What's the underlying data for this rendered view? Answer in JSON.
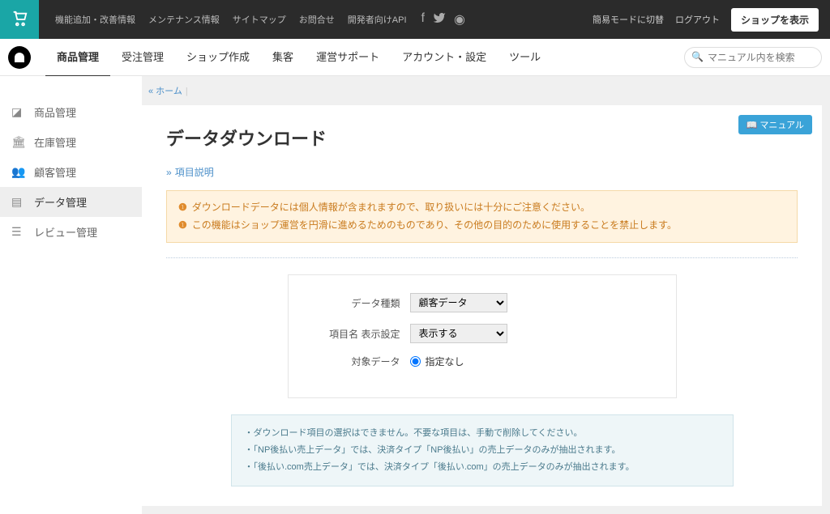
{
  "topbar": {
    "links": [
      "機能追加・改善情報",
      "メンテナンス情報",
      "サイトマップ",
      "お問合せ",
      "開発者向けAPI"
    ],
    "right": {
      "simple_mode": "簡易モードに切替",
      "logout": "ログアウト",
      "view_shop": "ショップを表示"
    }
  },
  "nav": {
    "items": [
      "商品管理",
      "受注管理",
      "ショップ作成",
      "集客",
      "運営サポート",
      "アカウント・設定",
      "ツール"
    ],
    "search_placeholder": "マニュアル内を検索"
  },
  "sidebar": {
    "items": [
      {
        "label": "商品管理",
        "icon": "cube"
      },
      {
        "label": "在庫管理",
        "icon": "building"
      },
      {
        "label": "顧客管理",
        "icon": "users"
      },
      {
        "label": "データ管理",
        "icon": "file",
        "active": true
      },
      {
        "label": "レビュー管理",
        "icon": "doc"
      }
    ]
  },
  "breadcrumb": {
    "home": "« ホーム"
  },
  "page": {
    "title": "データダウンロード",
    "manual_btn": "マニュアル",
    "field_desc": "項目説明",
    "alerts": [
      "ダウンロードデータには個人情報が含まれますので、取り扱いには十分にご注意ください。",
      "この機能はショップ運営を円滑に進めるためのものであり、その他の目的のために使用することを禁止します。"
    ],
    "form": {
      "data_type_label": "データ種類",
      "data_type_value": "顧客データ",
      "display_label": "項目名 表示設定",
      "display_value": "表示する",
      "target_label": "対象データ",
      "target_value": "指定なし"
    },
    "info": [
      "ダウンロード項目の選択はできません。不要な項目は、手動で削除してください。",
      "「NP後払い売上データ」では、決済タイプ「NP後払い」の売上データのみが抽出されます。",
      "「後払い.com売上データ」では、決済タイプ「後払い.com」の売上データのみが抽出されます。"
    ]
  }
}
